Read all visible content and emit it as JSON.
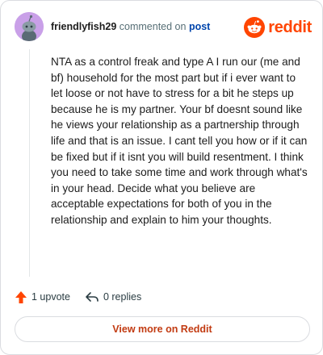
{
  "comment": {
    "username": "friendlyfish29",
    "verb": "commented on",
    "link_text": "post",
    "body": "NTA as a control freak and type A I run our (me and bf) household for the most part but if i ever want to let loose or not have to stress for a bit he steps up because he is my partner. Your bf doesnt sound like he views your relationship as a partnership through life and that is an issue. I cant tell you how or if it can be fixed but if it isnt you will build resentment. I think you need to take some time and work through what's in your head. Decide what you believe are acceptable expectations for both of you in the relationship and explain to him your thoughts.",
    "upvotes": "1 upvote",
    "replies": "0 replies"
  },
  "brand": {
    "name": "reddit",
    "color": "#ff4500"
  },
  "footer": {
    "view_more_label": "View more on Reddit"
  },
  "icons": {
    "avatar": "snoo-avatar-icon",
    "logo": "reddit-snoo-icon",
    "upvote": "upvote-arrow-icon",
    "reply": "reply-arrow-icon"
  },
  "colors": {
    "accent_upvote": "#ff4500",
    "link": "#0045ac",
    "button_text": "#c23b12",
    "avatar_bg": "#c9a0e8"
  }
}
